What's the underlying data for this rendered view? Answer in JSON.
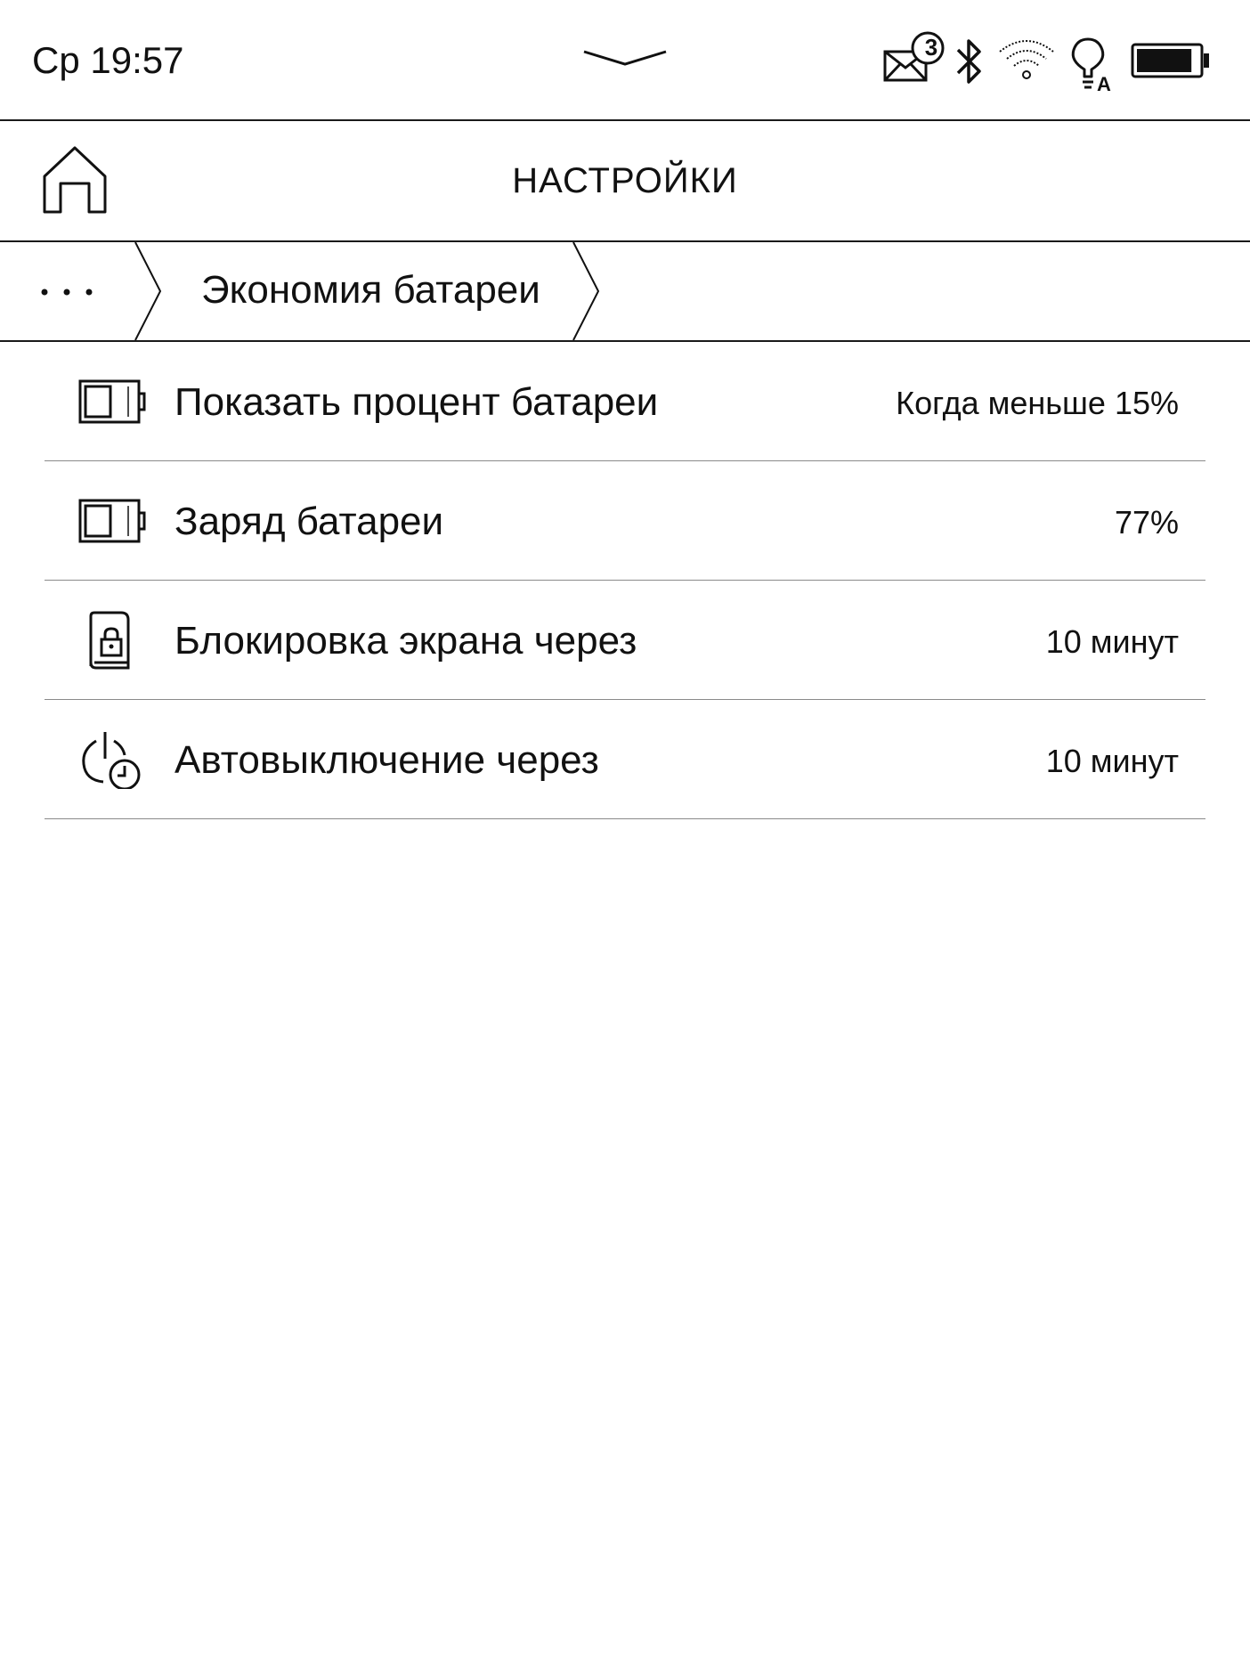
{
  "status_bar": {
    "time": "Ср 19:57",
    "unread_mail_count": "3",
    "icons": [
      "mail-icon",
      "bluetooth-icon",
      "wifi-icon",
      "frontlight-auto-icon",
      "battery-icon"
    ],
    "pulldown_icon": "chevron-down-icon",
    "battery_level": 0.9
  },
  "header": {
    "title": "НАСТРОЙКИ",
    "home_icon": "home-icon"
  },
  "breadcrumb": {
    "more_icon": "ellipsis-icon",
    "current": "Экономия батареи"
  },
  "settings": [
    {
      "icon": "battery-percent-icon",
      "label": "Показать процент батареи",
      "value": "Когда меньше 15%"
    },
    {
      "icon": "battery-charge-icon",
      "label": "Заряд батареи",
      "value": "77%"
    },
    {
      "icon": "screen-lock-icon",
      "label": "Блокировка экрана через",
      "value": "10 минут"
    },
    {
      "icon": "power-timer-icon",
      "label": "Автовыключение через",
      "value": "10 минут"
    }
  ],
  "colors": {
    "background": "#ffffff",
    "foreground": "#111111",
    "divider": "#8a8a8a"
  }
}
